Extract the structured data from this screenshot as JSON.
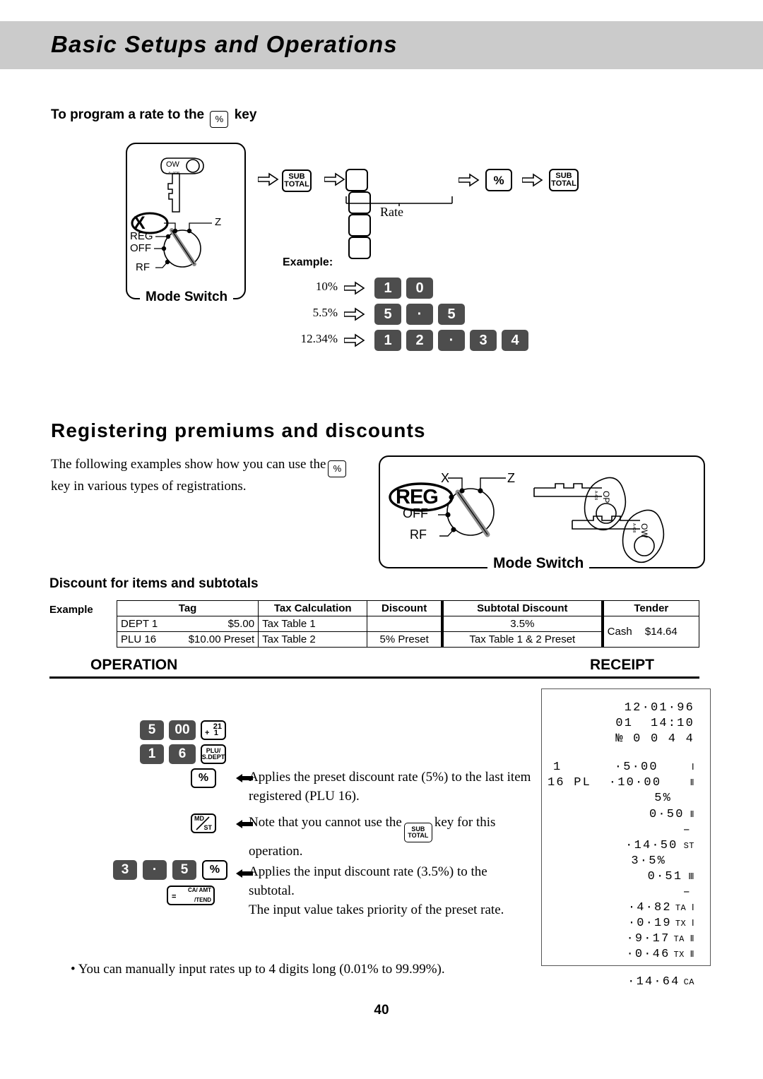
{
  "page": {
    "header_title": "Basic Setups and Operations",
    "page_number": "40",
    "accent_band": "#cbcbcb"
  },
  "section1": {
    "heading_before": "To program a rate to the",
    "heading_key": "%",
    "heading_after": "key",
    "mode_switch": {
      "caption": "Mode Switch",
      "selected": "X",
      "positions": [
        "X",
        "Z",
        "REG",
        "OFF",
        "RF"
      ],
      "key_label": "OW",
      "key_code": "A-408"
    },
    "flow": {
      "key1": {
        "line1": "SUB",
        "line2": "TOTAL"
      },
      "rate_label": "Rate",
      "rate_boxes": 4,
      "key2": "%",
      "key3": {
        "line1": "SUB",
        "line2": "TOTAL"
      }
    },
    "example": {
      "title": "Example:",
      "rows": [
        {
          "label": "10%",
          "keys": [
            "1",
            "0"
          ]
        },
        {
          "label": "5.5%",
          "keys": [
            "5",
            "·",
            "5"
          ]
        },
        {
          "label": "12.34%",
          "keys": [
            "1",
            "2",
            "·",
            "3",
            "4"
          ]
        }
      ]
    }
  },
  "section2": {
    "heading": "Registering premiums and discounts",
    "intro_before": "The following examples show how you can use the",
    "intro_key": "%",
    "intro_after": "key in various types of registrations.",
    "mode_switch": {
      "caption": "Mode Switch",
      "selected": "REG",
      "positions": [
        "X",
        "Z",
        "REG",
        "OFF",
        "RF"
      ],
      "keys": [
        {
          "label": "OP",
          "code": "A-409"
        },
        {
          "label": "OW",
          "code": "A-408"
        }
      ]
    },
    "subheading": "Discount for items and subtotals",
    "example_caption": "Example",
    "table": {
      "headers": [
        "Tag",
        "Tax Calculation",
        "Discount",
        "Subtotal Discount",
        "Tender"
      ],
      "rows": [
        {
          "tag_name": "DEPT 1",
          "tag_amount": "$5.00",
          "tax_calculation": "Tax Table 1",
          "discount": "",
          "subtotal_discount": "3.5%"
        },
        {
          "tag_name": "PLU 16",
          "tag_amount": "$10.00 Preset",
          "tax_calculation": "Tax Table 2",
          "discount": "5% Preset",
          "subtotal_discount": "Tax Table 1 & 2 Preset"
        }
      ],
      "tender_label": "Cash",
      "tender_amount": "$14.64"
    }
  },
  "operation": {
    "title": "OPERATION",
    "keys_row1": [
      "5",
      "00"
    ],
    "dept_key": {
      "top": "21",
      "bottom_sign": "+",
      "bottom_num": "1"
    },
    "keys_row2": [
      "1",
      "6"
    ],
    "plu_key": {
      "line1": "PLU/",
      "line2": "S.DEPT"
    },
    "percent_key": "%",
    "md_st_key": {
      "line1": "MD",
      "line2": "ST"
    },
    "keys_row3": [
      "3",
      "·",
      "5"
    ],
    "percent_key2": "%",
    "tender_key": {
      "sign": "=",
      "line1": "CA/ AMT",
      "line2": "/TEND"
    },
    "notes": [
      {
        "line1_a": "Applies the preset discount rate (5%) to the last  item",
        "line2": "registered (PLU 16)."
      },
      {
        "line1_a": "Note that you cannot use the",
        "inline_key": {
          "line1": "SUB",
          "line2": "TOTAL"
        },
        "line1_b": "key for this",
        "line2": "operation."
      },
      {
        "line1_a": "Applies the input discount rate (3.5%) to the subtotal.",
        "line2": "The input value takes priority of the preset rate."
      }
    ],
    "footnote": "•  You can manually input rates up to 4 digits long (0.01% to 99.99%)."
  },
  "receipt": {
    "title": "RECEIPT",
    "lines": [
      {
        "text": "12·01·96",
        "sub": ""
      },
      {
        "text": "01  14:10",
        "sub": ""
      },
      {
        "text": "№ 0 0 4 4",
        "sub": ""
      },
      {
        "text": "",
        "sub": ""
      },
      {
        "text": "1      ·5·00",
        "sub": "Ⅰ"
      },
      {
        "text": "16 PL  ·10·00",
        "sub": "Ⅱ"
      },
      {
        "text": "5%",
        "sub": ""
      },
      {
        "text": "0·50",
        "sub": "Ⅱ"
      },
      {
        "text": "–",
        "sub": ""
      },
      {
        "text": "·14·50",
        "sub": "ST"
      },
      {
        "text": "3·5%",
        "sub": ""
      },
      {
        "text": "0·51",
        "sub": "Ⅲ"
      },
      {
        "text": "–",
        "sub": ""
      },
      {
        "text": "·4·82",
        "sub": "TA Ⅰ"
      },
      {
        "text": "·0·19",
        "sub": "TX Ⅰ"
      },
      {
        "text": "·9·17",
        "sub": "TA Ⅱ"
      },
      {
        "text": "·0·46",
        "sub": "TX Ⅱ"
      },
      {
        "text": "",
        "sub": ""
      },
      {
        "text": "·14·64",
        "sub": "CA"
      }
    ]
  }
}
